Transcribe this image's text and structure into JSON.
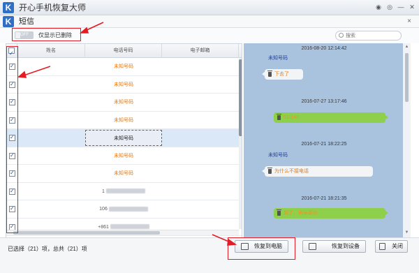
{
  "window": {
    "logo_letter": "K",
    "title": "开心手机恢复大师",
    "icons": [
      "wechat-icon",
      "chat-icon",
      "minimize-icon",
      "close-icon"
    ]
  },
  "module": {
    "logo_letter": "K",
    "title": "短信",
    "close_label": "×"
  },
  "filter": {
    "toggle_text": "OFF",
    "label": "仅显示已删除",
    "search_placeholder": "搜索"
  },
  "table": {
    "columns": [
      "姓名",
      "电话号码",
      "电子邮箱"
    ],
    "rows": [
      {
        "phone": "未知号码",
        "checked": true,
        "selected": false,
        "blurred": false
      },
      {
        "phone": "未知号码",
        "checked": true,
        "selected": false,
        "blurred": false
      },
      {
        "phone": "未知号码",
        "checked": true,
        "selected": false,
        "blurred": false
      },
      {
        "phone": "未知号码",
        "checked": true,
        "selected": false,
        "blurred": false
      },
      {
        "phone": "未知号码",
        "checked": true,
        "selected": true,
        "blurred": false
      },
      {
        "phone": "未知号码",
        "checked": true,
        "selected": false,
        "blurred": false
      },
      {
        "phone": "未知号码",
        "checked": true,
        "selected": false,
        "blurred": false
      },
      {
        "phone": "1",
        "checked": true,
        "selected": false,
        "blurred": true
      },
      {
        "phone": "106",
        "checked": true,
        "selected": false,
        "blurred": true
      },
      {
        "phone": "+861",
        "checked": true,
        "selected": false,
        "blurred": true
      }
    ]
  },
  "chat": {
    "messages": [
      {
        "time": "2016-08-20 12:14:42",
        "sender": "未知号码",
        "text": "下去了",
        "direction": "in"
      },
      {
        "time": "2016-07-27 13:17:46",
        "sender": "",
        "text": "511140",
        "direction": "out"
      },
      {
        "time": "2016-07-21 18:22:25",
        "sender": "未知号码",
        "text": "为什么不接电话",
        "direction": "in"
      },
      {
        "time": "2016-07-21 18:21:35",
        "sender": "",
        "text": "到了，把米菜炒",
        "direction": "out"
      }
    ]
  },
  "footer": {
    "status": "已选择（21）项，总共（21）项",
    "restore_pc": "恢复到电脑",
    "restore_device": "恢复到设备",
    "close": "关闭"
  },
  "colors": {
    "accent": "#2f6fc5",
    "unknown_number": "#e07a1a",
    "chat_bg": "#a9c3df",
    "outgoing_bubble": "#8ed04b",
    "annotation": "#e21d25"
  }
}
